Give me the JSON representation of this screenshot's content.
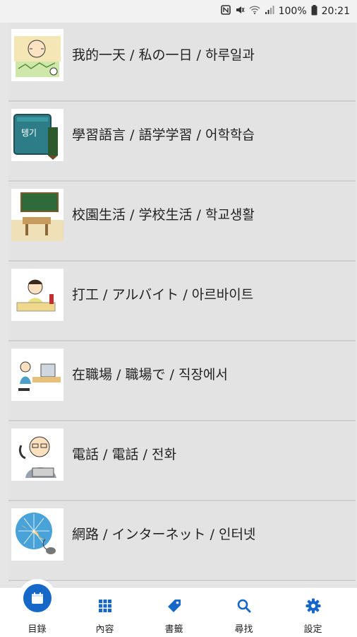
{
  "status_bar": {
    "icons": [
      "nfc-icon",
      "mute-icon",
      "wifi-icon",
      "signal-icon"
    ],
    "battery": "100%",
    "time": "20:21"
  },
  "list": {
    "items": [
      {
        "label": "我的一天 / 私の一日 / 하루일과",
        "icon": "daily-life-illustration"
      },
      {
        "label": "學習語言 / 語学学習 / 어학학습",
        "icon": "language-book-illustration"
      },
      {
        "label": "校園生活 / 学校生活 / 학교생활",
        "icon": "classroom-illustration"
      },
      {
        "label": "打工 / アルバイト / 아르바이트",
        "icon": "part-time-job-illustration"
      },
      {
        "label": "在職場 / 職場で / 직장에서",
        "icon": "office-desk-illustration"
      },
      {
        "label": "電話 / 電話 / 전화",
        "icon": "telephone-illustration"
      },
      {
        "label": "網路 / インターネット / 인터넷",
        "icon": "internet-globe-illustration"
      }
    ]
  },
  "tabbar": {
    "tabs": [
      {
        "label": "目錄",
        "icon": "calendar-icon",
        "active": true
      },
      {
        "label": "內容",
        "icon": "grid-icon",
        "active": false
      },
      {
        "label": "書籤",
        "icon": "tag-icon",
        "active": false
      },
      {
        "label": "尋找",
        "icon": "search-icon",
        "active": false
      },
      {
        "label": "設定",
        "icon": "gear-icon",
        "active": false
      }
    ],
    "accent_color": "#1567c8"
  }
}
